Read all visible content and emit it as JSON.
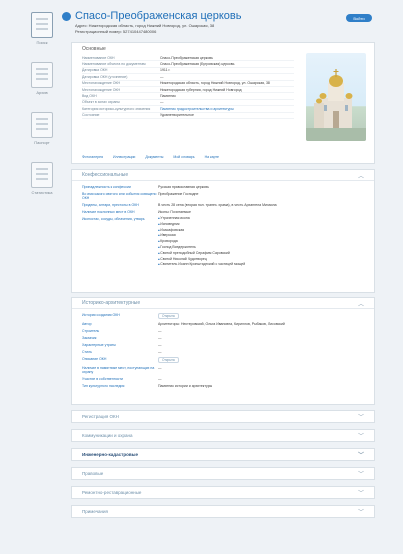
{
  "sidebar": {
    "items": [
      {
        "label": "Поиск"
      },
      {
        "label": "Архив"
      },
      {
        "label": "Паспорт"
      },
      {
        "label": "Статистика"
      }
    ]
  },
  "header": {
    "title": "Спасо-Преображенская церковь",
    "address": "Адрес: Нижегородская область, город Нижний Новгород, ул. Ошарская, 38",
    "reg_number": "Регистрационный номер: 527410447480006",
    "button": "Войти"
  },
  "main": {
    "section_title": "Основные",
    "rows": [
      {
        "k": "Наименование ОКН",
        "v": "Спасо-Преображенская церковь",
        "link": false
      },
      {
        "k": "Наименование объекта по документам",
        "v": "Спасо-Преображенская (Бугровская) церковь",
        "link": false
      },
      {
        "k": "Датировка ОКН",
        "v": "1911 г.",
        "link": false
      },
      {
        "k": "Датировка ОКН (уточнение)",
        "v": "—",
        "link": false
      },
      {
        "k": "Местонахождение ОКН",
        "v": "Нижегородская область, город Нижний Новгород, ул. Ошарская, 38",
        "link": false
      },
      {
        "k": "Местонахождение ОКН",
        "v": "Нижегородская губерния, город Нижний Новгород",
        "link": false
      },
      {
        "k": "Вид ОКН",
        "v": "Памятник",
        "link": false
      },
      {
        "k": "Объект в зонах охраны",
        "v": "—",
        "link": false
      },
      {
        "k": "Категория историко-культурного значения",
        "v": "Памятник градостроительства и архитектуры",
        "link": true
      },
      {
        "k": "Состояние",
        "v": "Удовлетворительное",
        "link": false
      }
    ],
    "tabs": [
      "Фотогалерея",
      "Иллюстрации",
      "Документы",
      "Мой словарь",
      "На карте"
    ]
  },
  "confession": {
    "title": "Конфессиональные",
    "rows": [
      {
        "k": "Принадлежность к конфессии",
        "v": "Русская православная церковь"
      },
      {
        "k": "Во имя какого святого или события освящено ОКН",
        "v": "Преображение Господне"
      },
      {
        "k": "Приделы, алтари, престолы в ОКН",
        "v": "В честь 28 сена (вторая пол. трапез. храма), в честь Архангела Михаила"
      },
      {
        "k": "Наличие поклонных мест в ОКН",
        "v": "Иконы: Почитаемые"
      }
    ],
    "bullets": [
      "Утраченная икона",
      "Исповедник",
      "Иоасафовская",
      "Иверская",
      "Кроворода",
      "Господ Вседержитель",
      "Святой преподобный Серафим Саровский",
      "Святой Николай Чудотворец",
      "Святитель Иоанн Кронштадтский с частицей мощей"
    ],
    "bullets_label": "Иконостас, сосуды, облачения, утварь"
  },
  "history": {
    "title": "Историко-архитектурные",
    "rows": [
      {
        "k": "История создания ОКН",
        "v": "Открыта",
        "tag": true
      },
      {
        "k": "Автор",
        "v": "Архитекторы: Нестеровский, Ольга Ивановна, Кириллов, Рыбаков, Лисовский",
        "tag": false
      },
      {
        "k": "Строитель",
        "v": "—",
        "tag": false
      },
      {
        "k": "Заказчик",
        "v": "—",
        "tag": false
      },
      {
        "k": "Характерные утраты",
        "v": "—",
        "tag": false
      },
      {
        "k": "Стиль",
        "v": "—",
        "tag": false
      },
      {
        "k": "Описание ОКН",
        "v": "Открыта",
        "tag": true
      },
      {
        "k": "Наличие в памятнике мест, поступающих на охрану",
        "v": "—",
        "tag": false
      },
      {
        "k": "Участие в собственности",
        "v": "—",
        "tag": false
      },
      {
        "k": "Тип культурного наследия",
        "v": "Памятник истории и архитектуры",
        "tag": false
      }
    ]
  },
  "collapsed_sections": [
    {
      "label": "Регистрация ОКН",
      "bold": false
    },
    {
      "label": "Коммуникации и охрана",
      "bold": false
    },
    {
      "label": "Инженерно-кадастровые",
      "bold": true
    },
    {
      "label": "Правовые",
      "bold": false
    },
    {
      "label": "Ремонтно-реставрационные",
      "bold": false
    },
    {
      "label": "Примечания",
      "bold": false
    }
  ],
  "icons": {
    "logo": "globe-icon",
    "chevron": "chevron-icon"
  }
}
